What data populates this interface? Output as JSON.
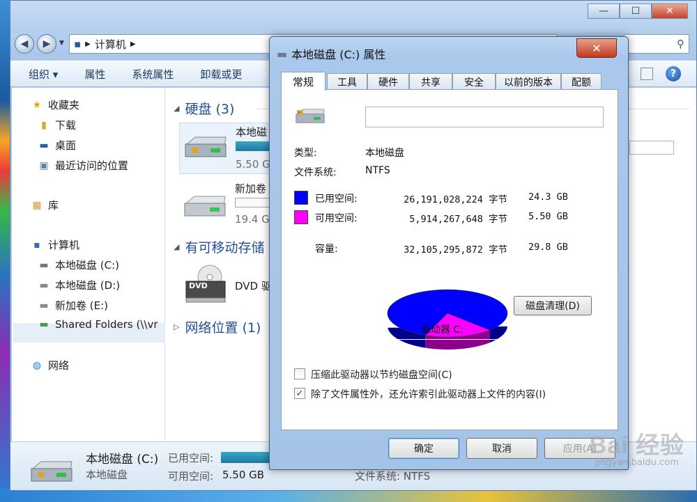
{
  "explorer": {
    "controls": {
      "minimize": "—",
      "maximize": "☐",
      "close": "✕"
    },
    "address_path": "计算机",
    "toolbar": [
      "组织 ▾",
      "属性",
      "系统属性",
      "卸载或更"
    ],
    "nav": {
      "favorites": "收藏夹",
      "downloads": "下载",
      "desktop": "桌面",
      "recent": "最近访问的位置",
      "libraries": "库",
      "computer": "计算机",
      "drive_c": "本地磁盘 (C:)",
      "drive_d": "本地磁盘 (D:)",
      "drive_e": "新加卷 (E:)",
      "shared": "Shared Folders (\\\\vr",
      "network": "网络"
    },
    "groups": {
      "hard_disks": "硬盘 (3)",
      "removable": "有可移动存储",
      "network_loc": "网络位置 (1)"
    },
    "tiles": {
      "c_name": "本地磁",
      "c_free": "5.50 G",
      "e_name": "新加卷",
      "e_free": "19.4 G",
      "dvd_name": "DVD 驱",
      "dvd_label": "DVD"
    },
    "details": {
      "name": "本地磁盘 (C:)",
      "type": "本地磁盘",
      "used_label": "已用空间:",
      "free_label": "可用空间:",
      "free_value": "5.50 GB",
      "fs": "文件系统: NTFS"
    }
  },
  "dialog": {
    "title": "本地磁盘 (C:) 属性",
    "close": "✕",
    "tabs": [
      "常规",
      "工具",
      "硬件",
      "共享",
      "安全",
      "以前的版本",
      "配额"
    ],
    "volume_name": "",
    "type_label": "类型:",
    "type_value": "本地磁盘",
    "fs_label": "文件系统:",
    "fs_value": "NTFS",
    "used": {
      "label": "已用空间:",
      "bytes": "26,191,028,224 字节",
      "size": "24.3 GB",
      "color": "#0000ff"
    },
    "free": {
      "label": "可用空间:",
      "bytes": "5,914,267,648 字节",
      "size": "5.50 GB",
      "color": "#ff00ff"
    },
    "capacity": {
      "label": "容量:",
      "bytes": "32,105,295,872 字节",
      "size": "29.8 GB"
    },
    "drive_label": "驱动器 C:",
    "cleanup_button": "磁盘清理(D)",
    "compress_label": "压缩此驱动器以节约磁盘空间(C)",
    "compress_checked": false,
    "index_label": "除了文件属性外，还允许索引此驱动器上文件的内容(I)",
    "index_checked": true,
    "ok": "确定",
    "cancel": "取消",
    "apply": "应用(A)"
  },
  "chart_data": {
    "type": "pie",
    "categories": [
      "已用空间",
      "可用空间"
    ],
    "values": [
      24.3,
      5.5
    ],
    "colors": [
      "#0000ff",
      "#ff00ff"
    ]
  },
  "watermark": {
    "logo": "Bai 经验",
    "url": "jingyan.baidu.com"
  }
}
